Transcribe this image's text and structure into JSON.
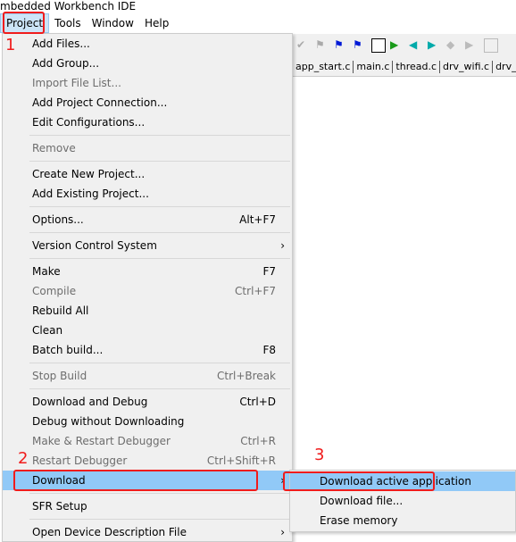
{
  "title": "mbedded Workbench IDE",
  "menubar": [
    "Project",
    "Tools",
    "Window",
    "Help"
  ],
  "tabs": [
    "app_start.c",
    "main.c",
    "thread.c",
    "drv_wifi.c",
    "drv_wla"
  ],
  "menu": [
    {
      "label": "Add Files..."
    },
    {
      "label": "Add Group..."
    },
    {
      "label": "Import File List...",
      "disabled": true
    },
    {
      "label": "Add Project Connection..."
    },
    {
      "label": "Edit Configurations..."
    },
    {
      "sep": true
    },
    {
      "label": "Remove",
      "disabled": true
    },
    {
      "sep": true
    },
    {
      "label": "Create New Project..."
    },
    {
      "label": "Add Existing Project..."
    },
    {
      "sep": true
    },
    {
      "label": "Options...",
      "shortcut": "Alt+F7"
    },
    {
      "sep": true
    },
    {
      "label": "Version Control System",
      "submenu": true
    },
    {
      "sep": true
    },
    {
      "label": "Make",
      "shortcut": "F7"
    },
    {
      "label": "Compile",
      "shortcut": "Ctrl+F7",
      "disabled": true
    },
    {
      "label": "Rebuild All"
    },
    {
      "label": "Clean"
    },
    {
      "label": "Batch build...",
      "shortcut": "F8"
    },
    {
      "sep": true
    },
    {
      "label": "Stop Build",
      "shortcut": "Ctrl+Break",
      "disabled": true
    },
    {
      "sep": true
    },
    {
      "label": "Download and Debug",
      "shortcut": "Ctrl+D"
    },
    {
      "label": "Debug without Downloading"
    },
    {
      "label": "Make & Restart Debugger",
      "shortcut": "Ctrl+R",
      "disabled": true
    },
    {
      "label": "Restart Debugger",
      "shortcut": "Ctrl+Shift+R",
      "disabled": true
    },
    {
      "label": "Download",
      "submenu": true,
      "highlighted": true
    },
    {
      "sep": true
    },
    {
      "label": "SFR Setup"
    },
    {
      "sep": true
    },
    {
      "label": "Open Device Description File",
      "submenu": true
    }
  ],
  "submenu": [
    "Download active application",
    "Download file...",
    "Erase memory"
  ],
  "annotations": [
    "1",
    "2",
    "3"
  ],
  "colors": {
    "highlight": "#91c9f7",
    "annotation": "#f01c1c"
  }
}
